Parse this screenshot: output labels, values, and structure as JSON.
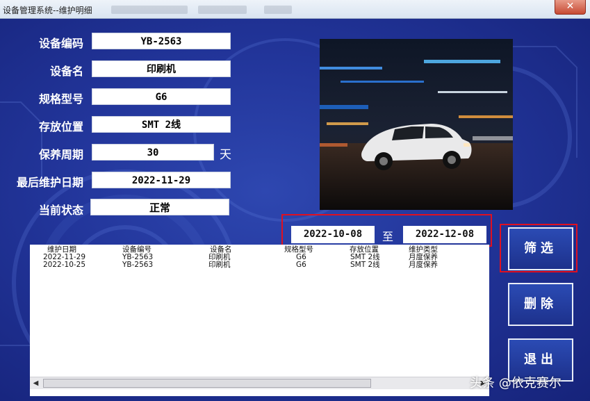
{
  "window": {
    "title": "设备管理系统--维护明细",
    "close_glyph": "✕"
  },
  "form": {
    "fields": [
      {
        "label": "设备编码",
        "value": "YB-2563"
      },
      {
        "label": "设备名",
        "value": "印刷机"
      },
      {
        "label": "规格型号",
        "value": "G6"
      },
      {
        "label": "存放位置",
        "value": "SMT 2线"
      },
      {
        "label": "保养周期",
        "value": "30"
      },
      {
        "label": "最后维护日期",
        "value": "2022-11-29"
      },
      {
        "label": "当前状态",
        "value": "正常"
      }
    ],
    "cycle_unit": "天"
  },
  "filter": {
    "from_date": "2022-10-08",
    "to_label": "至",
    "to_date": "2022-12-08"
  },
  "buttons": {
    "filter": "筛选",
    "delete": "删除",
    "exit": "退出"
  },
  "list": {
    "columns": [
      "维护日期",
      "设备编号",
      "设备名",
      "规格型号",
      "存放位置",
      "维护类型"
    ],
    "rows": [
      [
        "2022-11-29",
        "YB-2563",
        "印刷机",
        "G6",
        "SMT 2线",
        "月度保养"
      ],
      [
        "2022-10-25",
        "YB-2563",
        "印刷机",
        "G6",
        "SMT 2线",
        "月度保养"
      ]
    ]
  },
  "watermark": "头条 @依克赛尔",
  "colors": {
    "background": "#22359a",
    "highlight_frame": "#e01020",
    "button_fill": "#2b4bb4"
  },
  "icons": {
    "close": "close-icon",
    "scroll_left": "scroll-left-icon",
    "scroll_right": "scroll-right-icon"
  }
}
